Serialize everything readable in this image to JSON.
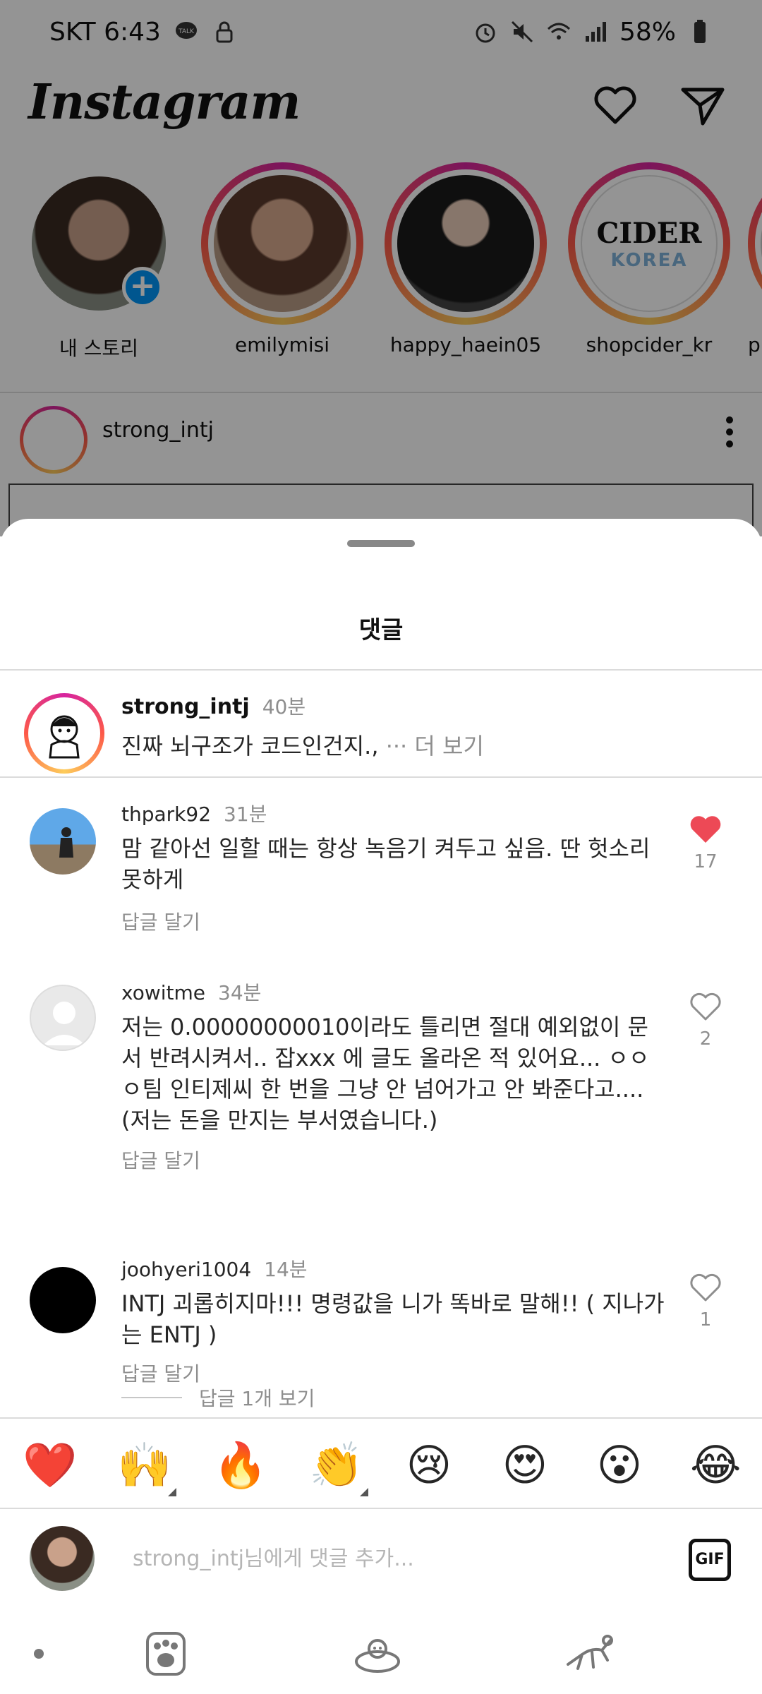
{
  "status_bar": {
    "carrier_time": "SKT 6:43",
    "battery": "58%"
  },
  "header": {
    "logo": "Instagram"
  },
  "stories": [
    {
      "name": "내 스토리",
      "icon": "my-story-add-icon"
    },
    {
      "name": "emilymisi"
    },
    {
      "name": "happy_haein05"
    },
    {
      "name": "shopcider_kr",
      "logo_line1": "CIDER",
      "logo_line2": "KOREA"
    },
    {
      "name": "pr"
    }
  ],
  "post": {
    "username": "strong_intj"
  },
  "sheet": {
    "title": "댓글",
    "caption": {
      "username": "strong_intj",
      "time": "40분",
      "text": "진짜 뇌구조가 코드인건지.,",
      "more": "··· 더 보기"
    },
    "comments": [
      {
        "username": "thpark92",
        "time": "31분",
        "text": "맘 같아선 일할 때는 항상 녹음기 켜두고 싶음. 딴 헛소리 못하게",
        "reply": "답글 달기",
        "likes": "17",
        "liked": true
      },
      {
        "username": "xowitme",
        "time": "34분",
        "text": "저는 0.00000000010이라도 틀리면 절대 예외없이 문서 반려시켜서.. 잡xxx 에 글도 올라온 적 있어요... ㅇㅇㅇ팀 인티제씨 한 번을 그냥 안 넘어가고 안 봐준다고....(저는 돈을 만지는 부서였습니다.)",
        "reply": "답글 달기",
        "likes": "2",
        "liked": false,
        "view_replies": "답글 1개 보기"
      },
      {
        "username": "joohyeri1004",
        "time": "14분",
        "text": "INTJ 괴롭히지마!!! 명령값을 니가 똑바로 말해!! ( 지나가는 ENTJ )",
        "reply": "답글 달기",
        "likes": "1",
        "liked": false
      }
    ],
    "emojis": [
      "❤️",
      "🙌",
      "🔥",
      "👏",
      "😢",
      "😍",
      "😮",
      "😂"
    ],
    "input": {
      "placeholder": "strong_intj님에게 댓글 추가...",
      "gif_label": "GIF"
    }
  },
  "colors": {
    "like_red": "#ed4956",
    "accent_blue": "#0095f6"
  }
}
